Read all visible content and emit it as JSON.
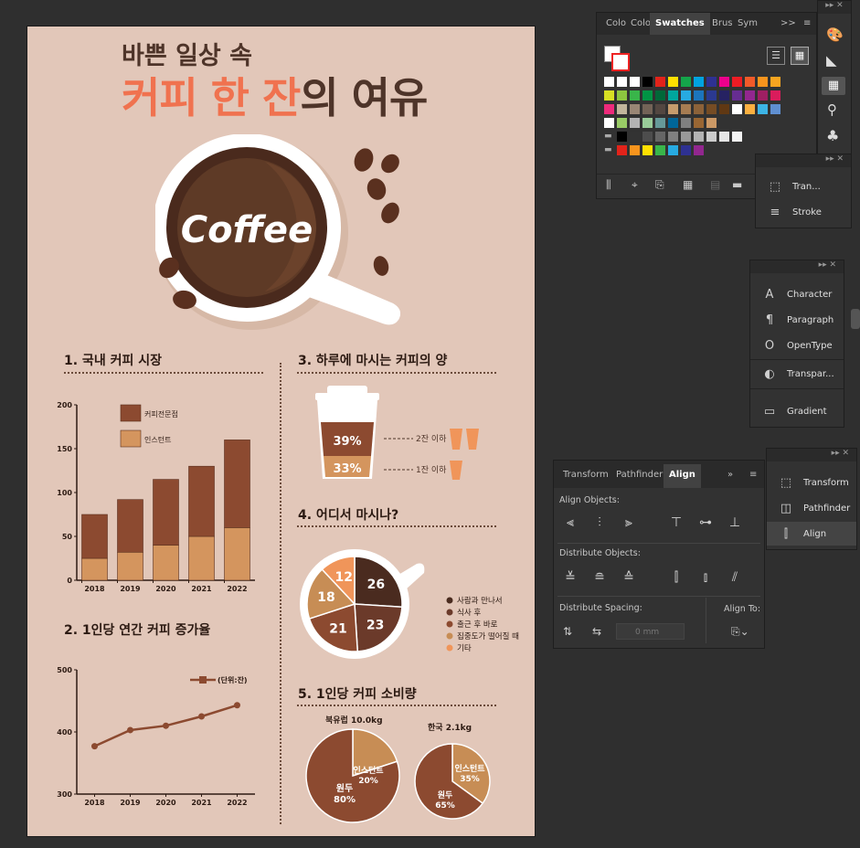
{
  "infographic": {
    "subtitle": "바쁜 일상 속",
    "title_accent": "커피 한 잔",
    "title_rest": "의 여유",
    "coffee_text": "Coffee",
    "section1": {
      "heading": "1. 국내 커피 시장",
      "legend": [
        "커피전문점",
        "인스턴트"
      ]
    },
    "section2": {
      "heading": "2. 1인당 연간 커피 증가율",
      "legend": "(단위:잔)"
    },
    "section3": {
      "heading": "3. 하루에 마시는 커피의 양",
      "pct_top": "39%",
      "pct_bottom": "33%",
      "label_top": "2잔 이하",
      "label_bottom": "1잔 이하"
    },
    "section4": {
      "heading": "4. 어디서 마시나?",
      "legend": [
        "사람과 만나서",
        "식사 후",
        "출근 후 바로",
        "집중도가 떨어질 때",
        "기타"
      ]
    },
    "section5": {
      "heading": "5. 1인당 커피 소비량",
      "eu_title": "북유럽 10.0kg",
      "kr_title": "한국 2.1kg",
      "eu_instant": "인스턴트",
      "eu_instant_pct": "20%",
      "eu_bean": "원두",
      "eu_bean_pct": "80%",
      "kr_instant": "인스턴트",
      "kr_instant_pct": "35%",
      "kr_bean": "원두",
      "kr_bean_pct": "65%"
    }
  },
  "chart_data": [
    {
      "type": "bar",
      "stacked": true,
      "categories": [
        "2018",
        "2019",
        "2020",
        "2021",
        "2022"
      ],
      "series": [
        {
          "name": "인스턴트",
          "values": [
            25,
            32,
            40,
            50,
            60
          ],
          "color": "#d4955e"
        },
        {
          "name": "커피전문점",
          "values": [
            50,
            60,
            75,
            80,
            100
          ],
          "color": "#8c4a30"
        }
      ],
      "ylim": [
        0,
        200
      ],
      "yticks": [
        "0",
        "50",
        "100",
        "150",
        "200"
      ]
    },
    {
      "type": "line",
      "x": [
        "2018",
        "2019",
        "2020",
        "2021",
        "2022"
      ],
      "series": [
        {
          "name": "(단위:잔)",
          "values": [
            377,
            403,
            410,
            425,
            443
          ],
          "color": "#8c4a30"
        }
      ],
      "ylim": [
        300,
        500
      ],
      "yticks": [
        "300",
        "400",
        "500"
      ]
    },
    {
      "type": "pie",
      "labels": [
        "사람과 만나서",
        "식사 후",
        "출근 후 바로",
        "집중도가 떨어질 때",
        "기타"
      ],
      "values": [
        26,
        23,
        21,
        18,
        12
      ],
      "colors": [
        "#4a2b1f",
        "#6b3a2a",
        "#8c4a30",
        "#c78d55",
        "#f0955a"
      ]
    },
    {
      "type": "pie",
      "title": "북유럽 10.0kg",
      "labels": [
        "원두",
        "인스턴트"
      ],
      "values": [
        80,
        20
      ]
    },
    {
      "type": "pie",
      "title": "한국 2.1kg",
      "labels": [
        "원두",
        "인스턴트"
      ],
      "values": [
        65,
        35
      ]
    }
  ],
  "swatches_panel": {
    "tabs": [
      "Colo",
      "Colo",
      "Swatches",
      "Brus",
      "Sym"
    ],
    "more": ">>"
  },
  "align_panel": {
    "tabs": [
      "Transform",
      "Pathfinder",
      "Align"
    ],
    "align_objects": "Align Objects:",
    "distribute_objects": "Distribute Objects:",
    "distribute_spacing": "Distribute Spacing:",
    "align_to": "Align To:",
    "spacing_value": "0 mm"
  },
  "side_panels": {
    "transform_short": "Tran...",
    "stroke": "Stroke",
    "character": "Character",
    "paragraph": "Paragraph",
    "opentype": "OpenType",
    "transparency": "Transpar...",
    "gradient": "Gradient",
    "transform": "Transform",
    "pathfinder": "Pathfinder",
    "align": "Align"
  },
  "colors": {
    "canvas": "#2f2f2f",
    "artboard": "#e2c7b9",
    "accent_orange": "#f0724f",
    "dark_brown": "#4e3429",
    "mid_brown": "#8c4a30",
    "light_brown": "#d4955e"
  }
}
